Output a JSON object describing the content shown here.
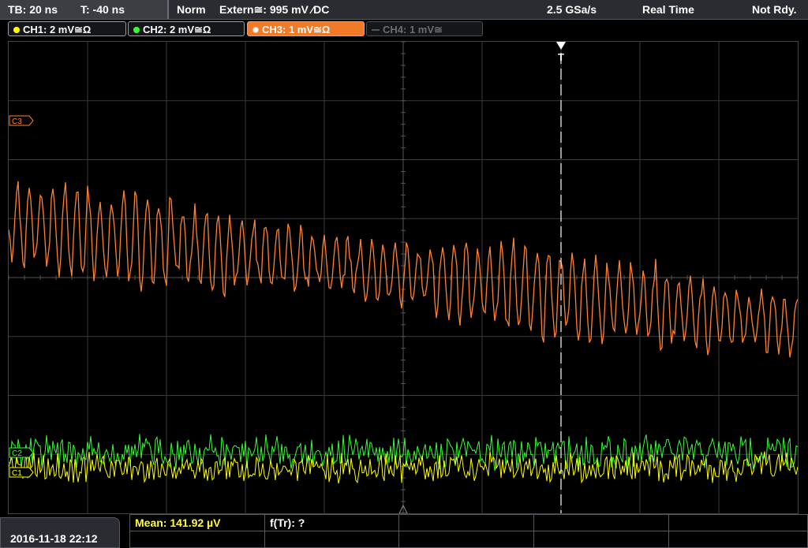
{
  "topbar": {
    "timebase": "TB: 20 ns",
    "trigger_time": "T: -40 ns",
    "mode": "Norm",
    "trigger_source": "Extern≅: 995 mV ⁄DC",
    "sample_rate": "2.5 GSa/s",
    "acquisition": "Real Time",
    "status": "Not Rdy."
  },
  "channels": [
    {
      "label": "CH1: 2 mV≅Ω",
      "color": "#ffff00",
      "state": "on"
    },
    {
      "label": "CH2: 2 mV≅Ω",
      "color": "#33ff33",
      "state": "on"
    },
    {
      "label": "CH3: 1 mV≅Ω",
      "color": "#ff8030",
      "state": "active"
    },
    {
      "label": "CH4: 1 mV≅",
      "color": "#666666",
      "state": "off"
    }
  ],
  "markers": {
    "ch3": "C3",
    "ch2": "C2",
    "ch1": "C1",
    "trigger": "T"
  },
  "measurements": {
    "mean": "Mean: 141.92 µV",
    "ftr": "f(Tr): ?"
  },
  "datetime": "2016-11-18 22:12",
  "colors": {
    "ch1": "#ffff00",
    "ch2": "#33ff33",
    "ch3": "#ff8030",
    "grid": "#3a3a3a"
  }
}
